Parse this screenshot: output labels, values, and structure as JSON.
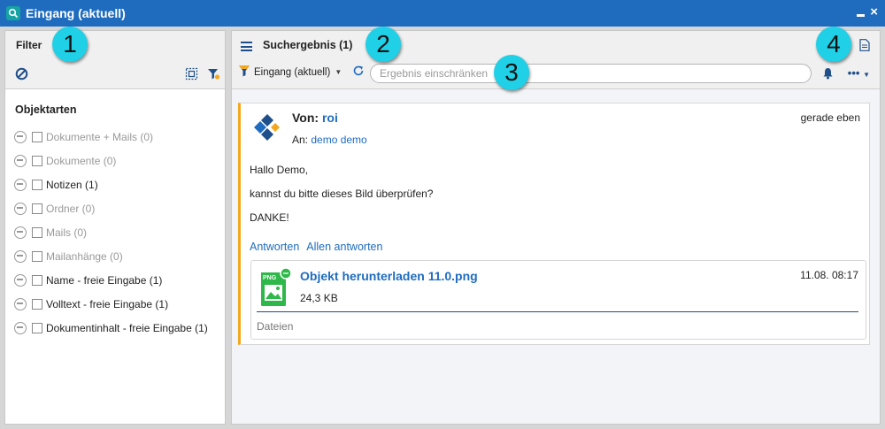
{
  "window": {
    "title": "Eingang (aktuell)"
  },
  "filter_pane": {
    "title": "Filter",
    "section_title": "Objektarten",
    "items": [
      {
        "label": "Dokumente + Mails (0)",
        "enabled": false
      },
      {
        "label": "Dokumente (0)",
        "enabled": false
      },
      {
        "label": "Notizen (1)",
        "enabled": true
      },
      {
        "label": "Ordner (0)",
        "enabled": false
      },
      {
        "label": "Mails (0)",
        "enabled": false
      },
      {
        "label": "Mailanhänge (0)",
        "enabled": false
      },
      {
        "label": "Name - freie Eingabe (1)",
        "enabled": true
      },
      {
        "label": "Volltext - freie Eingabe (1)",
        "enabled": true
      },
      {
        "label": "Dokumentinhalt - freie Eingabe (1)",
        "enabled": true
      }
    ]
  },
  "result_pane": {
    "title": "Suchergebnis (1)",
    "source_label": "Eingang (aktuell)",
    "search_placeholder": "Ergebnis einschränken",
    "more_label": "•••"
  },
  "note": {
    "from_prefix": "Von:",
    "from_name": "roi",
    "to_prefix": "An:",
    "to_name": "demo demo",
    "time": "gerade eben",
    "body": [
      "Hallo Demo,",
      "kannst du bitte dieses Bild überprüfen?",
      "DANKE!"
    ],
    "reply_label": "Antworten",
    "reply_all_label": "Allen antworten"
  },
  "attachment": {
    "title": "Objekt herunterladen 11.0.png",
    "size": "24,3 KB",
    "date": "11.08. 08:17",
    "tab_label": "Dateien",
    "type_label": "PNG"
  },
  "badges": [
    "1",
    "2",
    "3",
    "4"
  ],
  "colors": {
    "titlebar": "#1f6cbf",
    "accent": "#f2a81d",
    "link": "#1f6cbf",
    "badge": "#1fd0e6"
  }
}
